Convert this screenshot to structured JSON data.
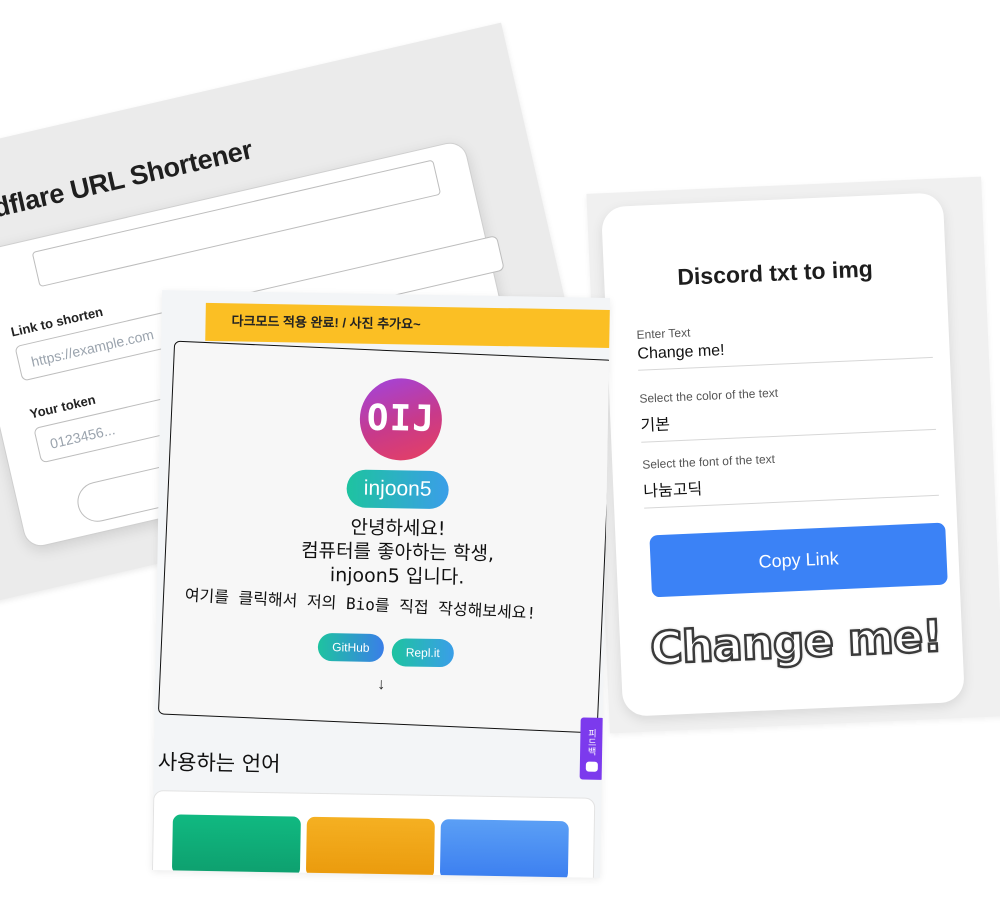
{
  "cloudflare": {
    "title": "Cloudflare URL Shortener",
    "link_label": "Link to shorten",
    "link_placeholder": "https://example.com",
    "token_label": "Your token",
    "token_placeholder": "0123456..."
  },
  "discord": {
    "title": "Discord txt to img",
    "text_label": "Enter Text",
    "text_value": "Change me!",
    "color_label": "Select the color of the text",
    "color_value": "기본",
    "font_label": "Select the font of the text",
    "font_value": "나눔고딕",
    "button_label": "Copy Link",
    "preview_text": "Change me!"
  },
  "bio": {
    "banner": "다크모드 적용 완료! / 사진 추가요~",
    "avatar_text": "OIJ",
    "username": "injoon5",
    "greeting_line1": "안녕하세요!",
    "greeting_line2": "컴퓨터를 좋아하는 학생,",
    "greeting_line3": "injoon5 입니다.",
    "cta": "여기를 클릭해서 저의 Bio를 직접 작성해보세요!",
    "links": [
      {
        "label": "GitHub",
        "color_from": "#1ec3a0",
        "color_to": "#3a7ee8"
      },
      {
        "label": "Repl.it",
        "color_from": "#1ec3a0",
        "color_to": "#3a9ee8"
      }
    ],
    "arrow": "↓",
    "feedback_label": "피드백",
    "languages_title": "사용하는 언어",
    "language_tile_colors": [
      "#10b981",
      "#f5b022",
      "#5b8ff5"
    ]
  }
}
